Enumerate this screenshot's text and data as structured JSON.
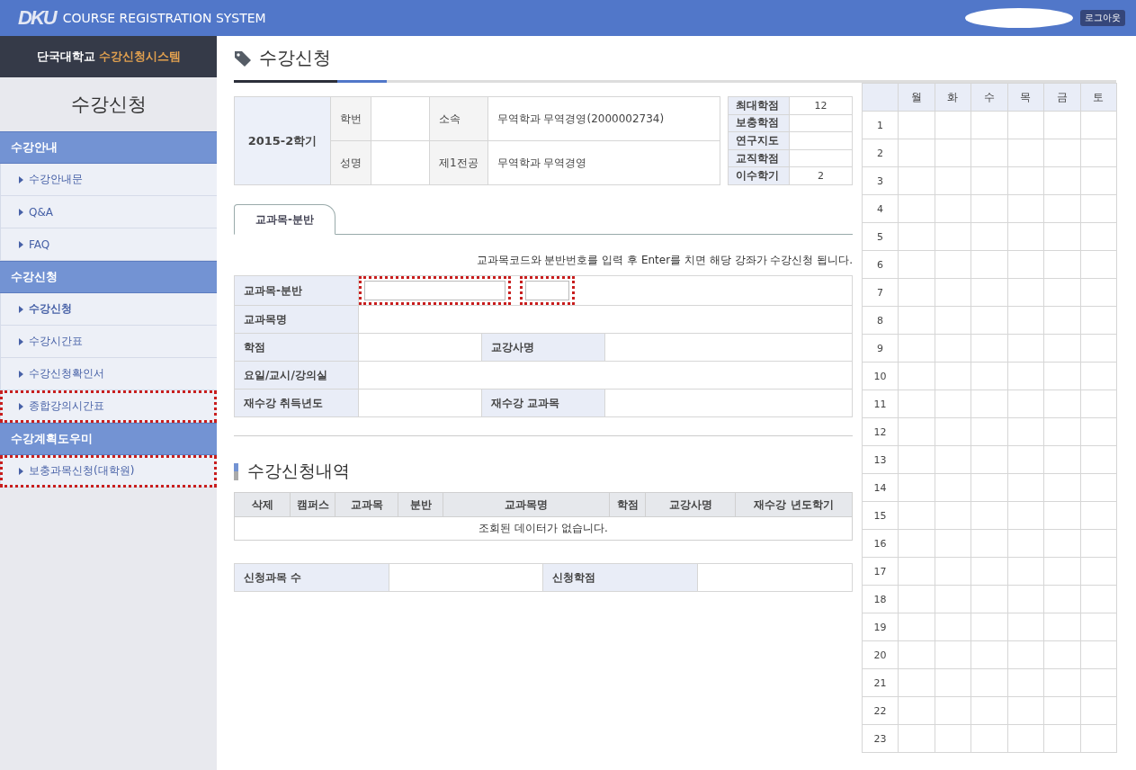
{
  "header": {
    "logo": "DKU",
    "system_name": "COURSE REGISTRATION SYSTEM",
    "logout": "로그아웃"
  },
  "sidebar": {
    "brand": "단국대학교",
    "brand_accent": "수강신청시스템",
    "title": "수강신청",
    "groups": [
      {
        "label": "수강안내",
        "items": [
          {
            "label": "수강안내문",
            "selected": false,
            "highlighted": false
          },
          {
            "label": "Q&A",
            "selected": false,
            "highlighted": false
          },
          {
            "label": "FAQ",
            "selected": false,
            "highlighted": false
          }
        ]
      },
      {
        "label": "수강신청",
        "items": [
          {
            "label": "수강신청",
            "selected": true,
            "highlighted": false
          },
          {
            "label": "수강시간표",
            "selected": false,
            "highlighted": false
          },
          {
            "label": "수강신청확인서",
            "selected": false,
            "highlighted": false
          },
          {
            "label": "종합강의시간표",
            "selected": false,
            "highlighted": true
          }
        ]
      },
      {
        "label": "수강계획도우미",
        "items": [
          {
            "label": "보충과목신청(대학원)",
            "selected": false,
            "highlighted": true
          }
        ]
      }
    ]
  },
  "page_title": "수강신청",
  "student_info": {
    "semester": "2015-2학기",
    "rows": [
      [
        {
          "label": "학번"
        },
        {
          "label": "소속",
          "value": "무역학과 무역경영(2000002734)"
        }
      ],
      [
        {
          "label": "성명"
        },
        {
          "label": "제1전공",
          "value": "무역학과 무역경영"
        }
      ]
    ]
  },
  "credits": [
    {
      "label": "최대학점",
      "value": "12"
    },
    {
      "label": "보충학점"
    },
    {
      "label": "연구지도"
    },
    {
      "label": "교직학점"
    },
    {
      "label": "이수학기",
      "value": "2"
    }
  ],
  "tabs": [
    {
      "label": "교과목-분반",
      "selected": true
    }
  ],
  "hint": "교과목코드와 분반번호를 입력 후 Enter를 치면 해당 강좌가 수강신청 됩니다.",
  "course_form": {
    "code_label": "교과목-분반",
    "code_field_highlighted": true,
    "section_field_highlighted": true,
    "rows": [
      [
        {
          "label": "교과목명"
        }
      ],
      [
        {
          "label": "학점"
        },
        {
          "label": "교강사명"
        }
      ],
      [
        {
          "label": "요일/교시/강의실"
        }
      ],
      [
        {
          "label": "재수강 취득년도"
        },
        {
          "label": "재수강 교과목"
        }
      ]
    ]
  },
  "history": {
    "title": "수강신청내역",
    "columns": [
      "삭제",
      "캠퍼스",
      "교과목",
      "분반",
      "교과목명",
      "학점",
      "교강사명",
      "재수강 년도학기"
    ],
    "empty_message": "조회된 데이터가 없습니다."
  },
  "summary": [
    {
      "label": "신청과목 수"
    },
    {
      "label": "신청학점"
    }
  ],
  "timetable": {
    "days": [
      "월",
      "화",
      "수",
      "목",
      "금",
      "토"
    ],
    "periods": [
      "1",
      "2",
      "3",
      "4",
      "5",
      "6",
      "7",
      "8",
      "9",
      "10",
      "11",
      "12",
      "13",
      "14",
      "15",
      "16",
      "17",
      "18",
      "19",
      "20",
      "21",
      "22",
      "23"
    ]
  }
}
